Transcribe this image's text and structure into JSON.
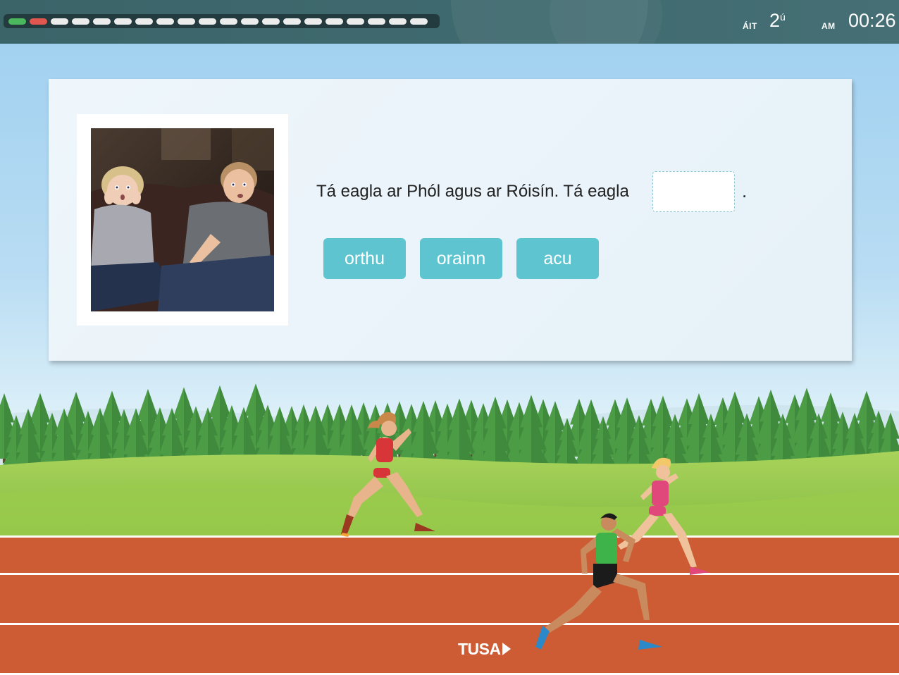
{
  "progress": {
    "segments": [
      "correct",
      "wrong",
      "pending",
      "pending",
      "pending",
      "pending",
      "pending",
      "pending",
      "pending",
      "pending",
      "pending",
      "pending",
      "pending",
      "pending",
      "pending",
      "pending",
      "pending",
      "pending",
      "pending",
      "pending"
    ],
    "colors": {
      "correct": "#4cb85e",
      "wrong": "#e0574f",
      "pending": "#ececec"
    }
  },
  "position": {
    "label": "ÁIT",
    "value": "2",
    "suffix": "ú"
  },
  "time": {
    "label": "AM",
    "value": "00:26"
  },
  "question": {
    "text": "Tá eagla ar Phól agus ar Róisín. Tá eagla",
    "answer_value": "",
    "end_punct": "."
  },
  "options": [
    "orthu",
    "orainn",
    "acu"
  ],
  "player_marker": "TUSA",
  "colors": {
    "option_bg": "#5ec4cf",
    "track": "#cd5c34",
    "topbar": "#3f6a6f"
  }
}
